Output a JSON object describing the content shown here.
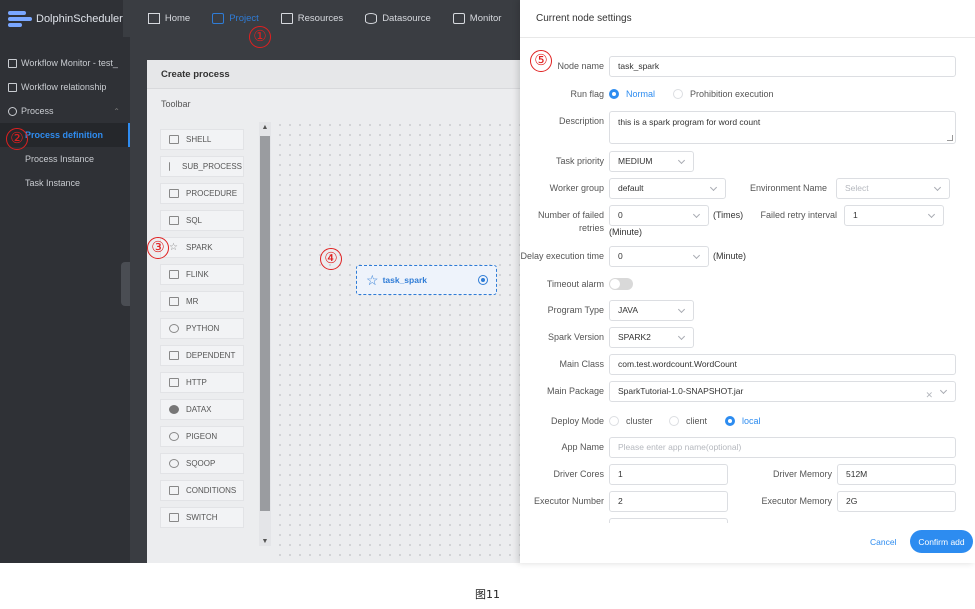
{
  "app": {
    "logo_text": "DolphinScheduler",
    "nav": [
      {
        "label": "Home",
        "icon": "home-icon"
      },
      {
        "label": "Project",
        "icon": "project-icon",
        "active": true
      },
      {
        "label": "Resources",
        "icon": "folder-icon"
      },
      {
        "label": "Datasource",
        "icon": "database-icon"
      },
      {
        "label": "Monitor",
        "icon": "monitor-icon"
      }
    ],
    "accent_color": "#2f7cd6"
  },
  "sidebar": {
    "items": [
      {
        "label": "Workflow Monitor - test_"
      },
      {
        "label": "Workflow relationship"
      },
      {
        "label": "Process"
      },
      {
        "label": "Process definition",
        "active": true
      },
      {
        "label": "Process Instance"
      },
      {
        "label": "Task Instance"
      }
    ]
  },
  "canvas": {
    "title": "Create process",
    "toolbar_title": "Toolbar",
    "tools": [
      "SHELL",
      "SUB_PROCESS",
      "PROCEDURE",
      "SQL",
      "SPARK",
      "FLINK",
      "MR",
      "PYTHON",
      "DEPENDENT",
      "HTTP",
      "DATAX",
      "PIGEON",
      "SQOOP",
      "CONDITIONS",
      "SWITCH"
    ],
    "node_label": "task_spark"
  },
  "markers": [
    "①",
    "②",
    "③",
    "④",
    "⑤"
  ],
  "drawer": {
    "title": "Current node settings",
    "node_name_label": "Node name",
    "node_name_value": "task_spark",
    "run_flag_label": "Run flag",
    "run_flag_options": [
      "Normal",
      "Prohibition execution"
    ],
    "description_label": "Description",
    "description_value": "this is a spark program for word count",
    "task_priority_label": "Task priority",
    "task_priority_value": "MEDIUM",
    "worker_group_label": "Worker group",
    "worker_group_value": "default",
    "environment_name_label": "Environment Name",
    "environment_name_placeholder": "Select",
    "failed_retries_label_1": "Number of failed",
    "failed_retries_label_2": "retries",
    "failed_retries_value": "0",
    "failed_retries_unit": "(Times)",
    "failed_retry_interval_label": "Failed retry interval",
    "failed_retry_interval_value": "1",
    "failed_retry_interval_unit": "(Minute)",
    "delay_label": "Delay execution time",
    "delay_value": "0",
    "delay_unit": "(Minute)",
    "timeout_label": "Timeout alarm",
    "program_type_label": "Program Type",
    "program_type_value": "JAVA",
    "spark_version_label": "Spark Version",
    "spark_version_value": "SPARK2",
    "main_class_label": "Main Class",
    "main_class_value": "com.test.wordcount.WordCount",
    "main_package_label": "Main Package",
    "main_package_value": "SparkTutorial-1.0-SNAPSHOT.jar",
    "deploy_mode_label": "Deploy Mode",
    "deploy_mode_options": [
      "cluster",
      "client",
      "local"
    ],
    "app_name_label": "App Name",
    "app_name_placeholder": "Please enter app name(optional)",
    "driver_cores_label": "Driver Cores",
    "driver_cores_value": "1",
    "driver_memory_label": "Driver Memory",
    "driver_memory_value": "512M",
    "executor_number_label": "Executor Number",
    "executor_number_value": "2",
    "executor_memory_label": "Executor Memory",
    "executor_memory_value": "2G",
    "cancel_label": "Cancel",
    "confirm_label": "Confirm add"
  },
  "caption": "图11"
}
